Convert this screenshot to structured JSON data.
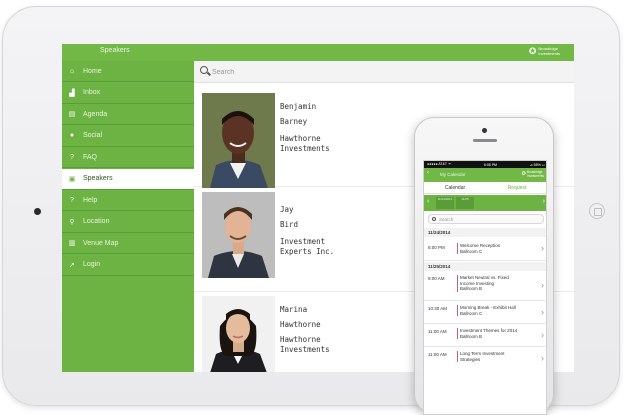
{
  "tablet": {
    "app_title": "Speakers",
    "logo_text": "Broadridge\nInvestments",
    "nav": [
      {
        "label": "Home",
        "icon": "home-icon",
        "glyph": "⌂"
      },
      {
        "label": "Inbox",
        "icon": "inbox-icon",
        "glyph": "▟"
      },
      {
        "label": "Agenda",
        "icon": "agenda-icon",
        "glyph": "▤"
      },
      {
        "label": "Social",
        "icon": "social-icon",
        "glyph": "●"
      },
      {
        "label": "FAQ",
        "icon": "faq-icon",
        "glyph": "?"
      },
      {
        "label": "Speakers",
        "icon": "speakers-icon",
        "glyph": "▣",
        "active": true
      },
      {
        "label": "Help",
        "icon": "help-icon",
        "glyph": "?"
      },
      {
        "label": "Location",
        "icon": "location-icon",
        "glyph": "⚲"
      },
      {
        "label": "Venue Map",
        "icon": "map-icon",
        "glyph": "▥"
      },
      {
        "label": "Login",
        "icon": "login-icon",
        "glyph": "➚"
      }
    ],
    "search": {
      "placeholder": "Search"
    },
    "speakers": [
      {
        "first": "Benjamin",
        "last": "Barney",
        "company_1": "Hawthorne",
        "company_2": "Investments"
      },
      {
        "first": "Jay",
        "last": "Bird",
        "company_1": "Investment",
        "company_2": "Experts Inc."
      },
      {
        "first": "Marina",
        "last": "Hawthorne",
        "company_1": "Hawthorne",
        "company_2": "Investments"
      }
    ]
  },
  "phone": {
    "status_left": "●●●●● AT&T ᯤ",
    "status_time": "6:08 PM",
    "status_right": "⊿ 58% ▭",
    "title": "My Calendar",
    "logo_text": "Broadridge\nInvestments",
    "tabs": [
      "Calendar",
      "Request"
    ],
    "search_placeholder": "Search",
    "days": [
      {
        "label": "11/24/2014"
      },
      {
        "label": "11/25"
      }
    ],
    "dates": [
      "11/24/2014",
      "11/25/2014"
    ],
    "events": [
      {
        "time": "6:00 PM",
        "lines": [
          "Welcome Reception",
          "Ballroom C"
        ]
      },
      {
        "time": "9:00 AM",
        "lines": [
          "Market Neutral vs. Fixed",
          "Income Investing",
          "Ballroom B"
        ]
      },
      {
        "time": "10:30 AM",
        "lines": [
          "Morning Break - Exhibit Hall",
          "Ballroom C"
        ]
      },
      {
        "time": "11:00 AM",
        "lines": [
          "Investment Themes for 2014",
          "Ballroom B"
        ]
      },
      {
        "time": "11:00 AM",
        "lines": [
          "Long Term Investment",
          "Strategies"
        ]
      }
    ]
  }
}
